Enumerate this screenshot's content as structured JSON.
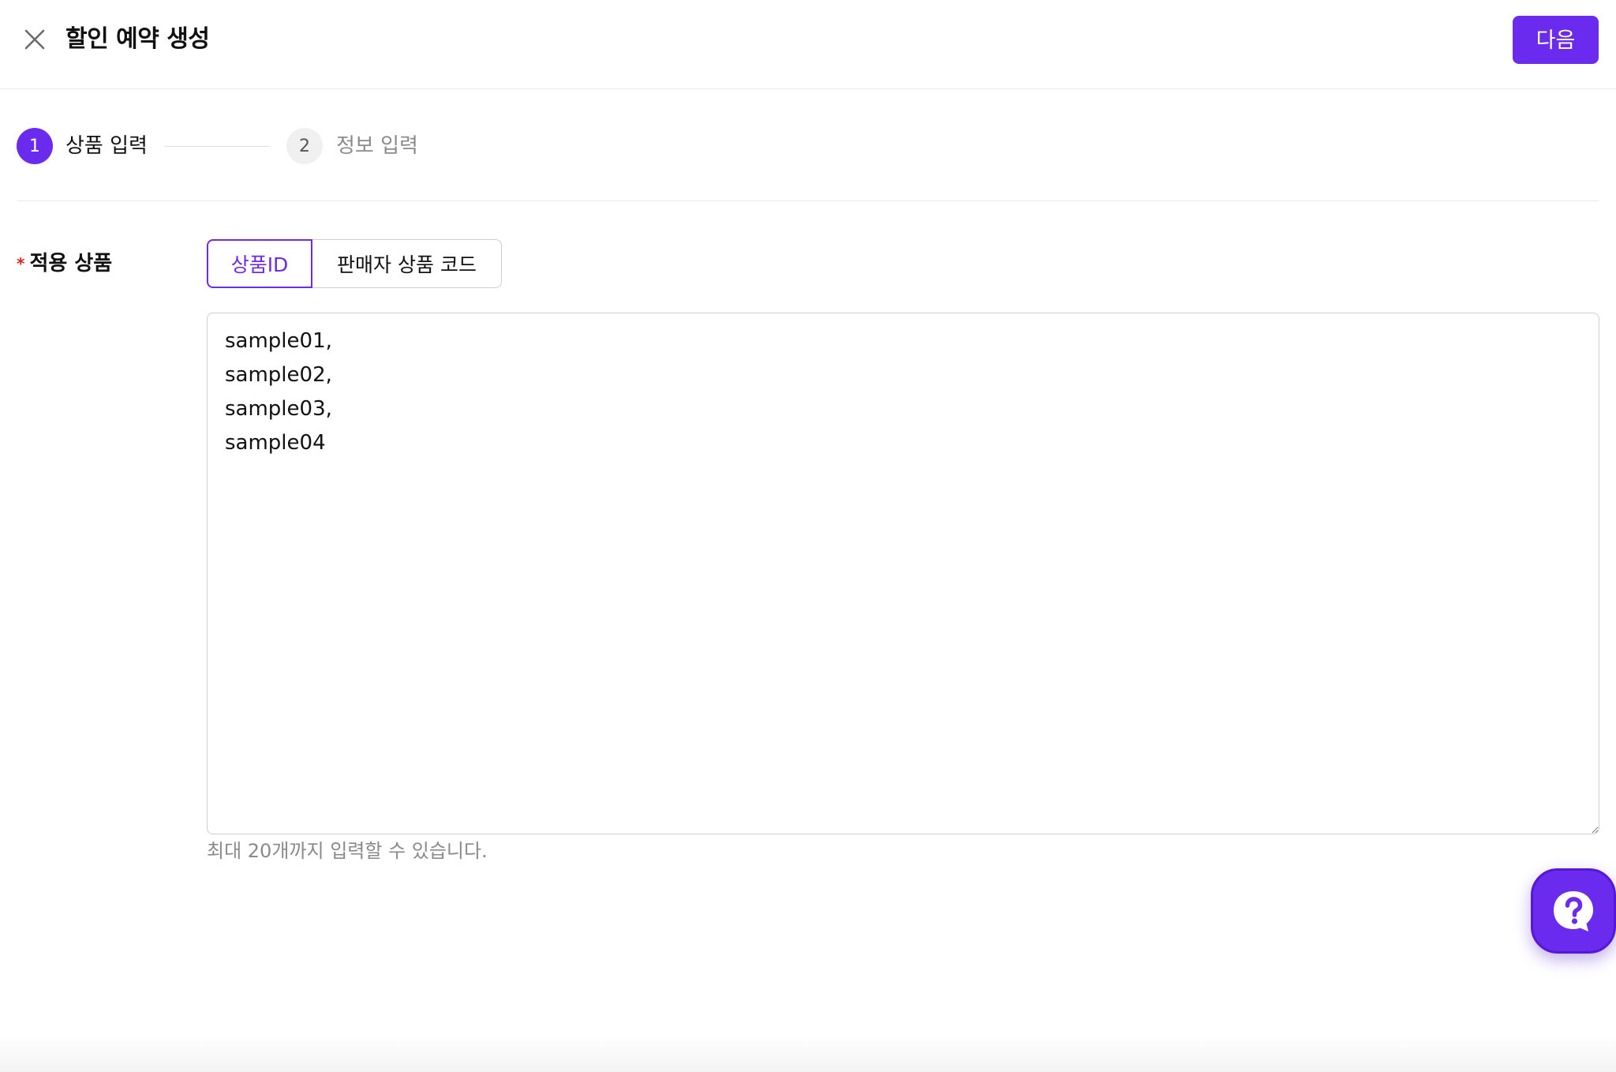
{
  "header": {
    "title": "할인 예약 생성",
    "close_icon": "close-icon",
    "next_label": "다음"
  },
  "stepper": {
    "steps": [
      {
        "number": "1",
        "label": "상품 입력",
        "state": "active"
      },
      {
        "number": "2",
        "label": "정보 입력",
        "state": "inactive"
      }
    ]
  },
  "form": {
    "field_label": "적용 상품",
    "required_mark": "*",
    "input_type_options": [
      {
        "label": "상품ID",
        "selected": true
      },
      {
        "label": "판매자 상품 코드",
        "selected": false
      }
    ],
    "product_input_value": "sample01,\nsample02,\nsample03,\nsample04",
    "helper_text": "최대 20개까지 입력할 수 있습니다."
  },
  "help_fab": {
    "icon": "help-chat-icon"
  },
  "colors": {
    "accent": "#6a2bef",
    "required": "#e02020",
    "muted_text": "#8a8a8a",
    "border": "#cfcfcf"
  }
}
